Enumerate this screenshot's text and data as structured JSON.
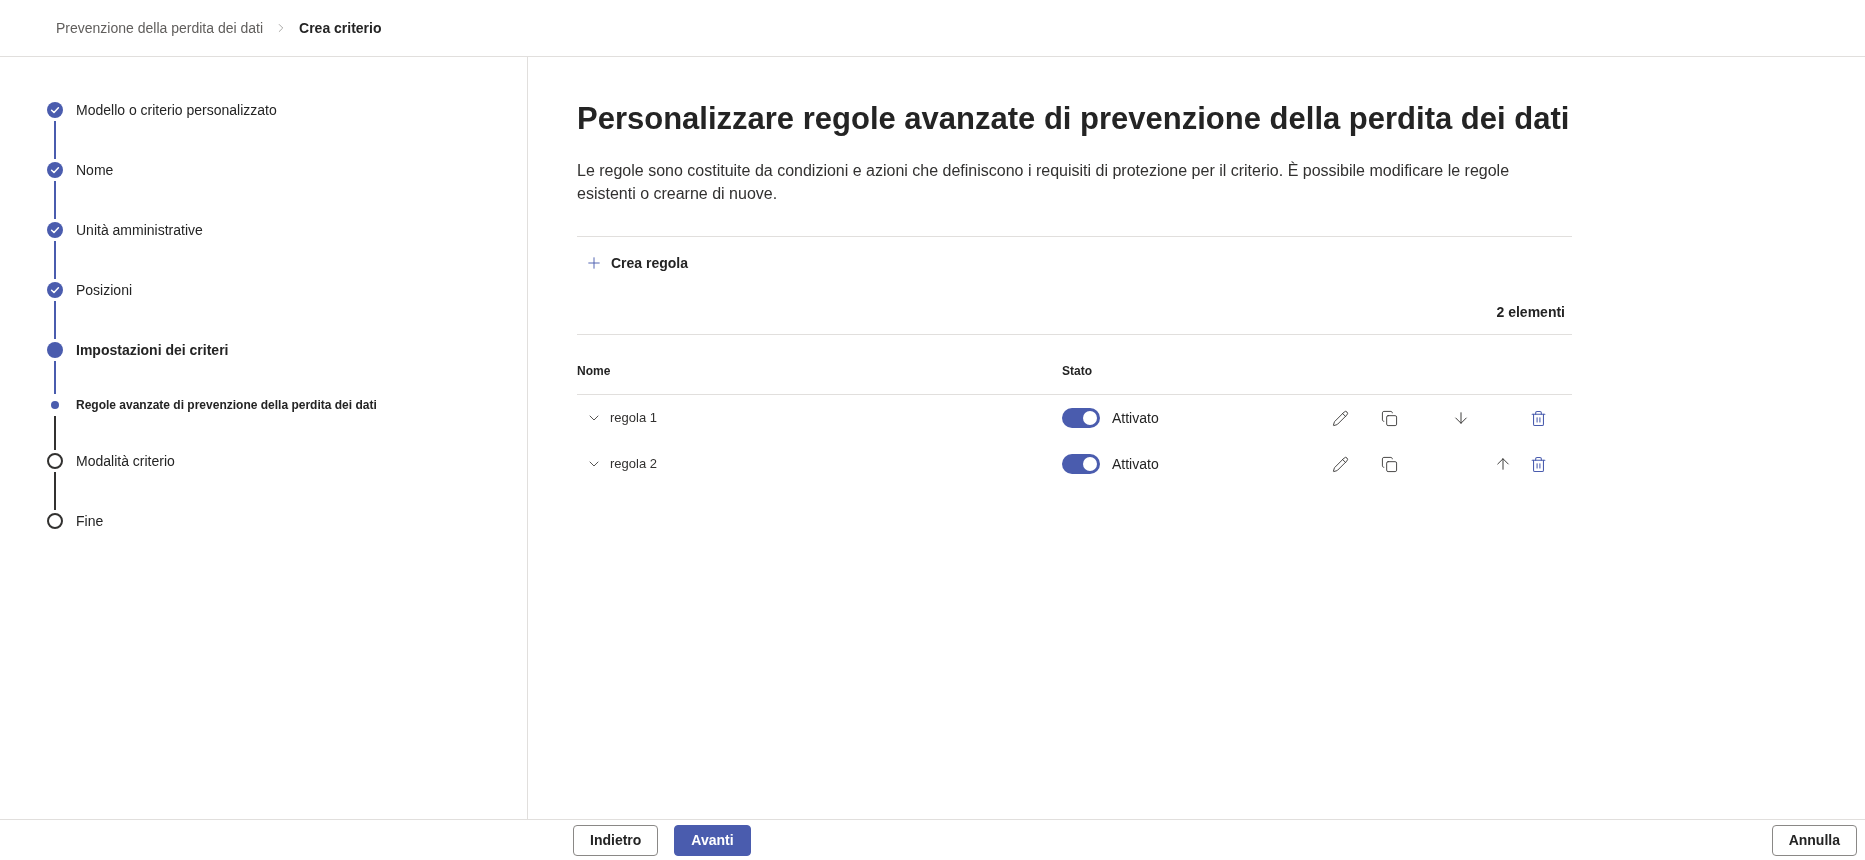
{
  "breadcrumb": [
    {
      "label": "Prevenzione della perdita dei dati",
      "current": false
    },
    {
      "label": "Crea criterio",
      "current": true
    }
  ],
  "steps": [
    {
      "label": "Modello o criterio personalizzato",
      "completed": true,
      "current": false
    },
    {
      "label": "Nome",
      "completed": true,
      "current": false
    },
    {
      "label": "Unità amministrative",
      "completed": true,
      "current": false
    },
    {
      "label": "Posizioni",
      "completed": true,
      "current": false
    },
    {
      "label": "Impostazioni dei criteri",
      "completed": false,
      "current": true,
      "children": [
        {
          "label": "Regole avanzate di prevenzione della perdita dei dati",
          "completed": false,
          "current": true
        }
      ]
    },
    {
      "label": "Modalità criterio",
      "completed": false,
      "current": false
    },
    {
      "label": "Fine",
      "completed": false,
      "current": false
    }
  ],
  "main": {
    "title": "Personalizzare regole avanzate di prevenzione della perdita dei dati",
    "description": "Le regole sono costituite da condizioni e azioni che definiscono i requisiti di protezione per il criterio. È possibile modificare le regole esistenti o crearne di nuove.",
    "create_button": "Crea regola",
    "item_count": "2 elementi"
  },
  "table": {
    "columns": [
      "Nome",
      "Stato"
    ],
    "rows": [
      {
        "name": "regola 1",
        "expanded": false,
        "on": true,
        "state_label": "Attivato",
        "can_move_up": false,
        "can_move_down": true
      },
      {
        "name": "regola 2",
        "expanded": false,
        "on": true,
        "state_label": "Attivato",
        "can_move_up": true,
        "can_move_down": false
      }
    ]
  },
  "footer": {
    "buttons": [
      {
        "label": "Indietro",
        "primary": false
      },
      {
        "label": "Avanti",
        "primary": true
      }
    ],
    "cancel": "Annulla"
  }
}
